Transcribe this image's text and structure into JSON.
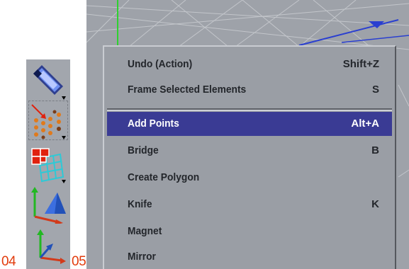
{
  "captions": {
    "left": "04",
    "right": "05"
  },
  "toolbar": {
    "tools": [
      {
        "icon": "pen-tool-icon"
      },
      {
        "icon": "add-points-tool-icon",
        "selected": true
      },
      {
        "icon": "polygon-grid-tool-icon"
      },
      {
        "icon": "axis-transform-icon"
      },
      {
        "icon": "axis-coordinate-icon"
      }
    ]
  },
  "context_menu": {
    "items": [
      {
        "label": "Undo (Action)",
        "shortcut": "Shift+Z"
      },
      {
        "label": "Frame Selected Elements",
        "shortcut": "S"
      },
      {
        "label": "Add Points",
        "shortcut": "Alt+A",
        "highlighted": true
      },
      {
        "label": "Bridge",
        "shortcut": "B"
      },
      {
        "label": "Create Polygon",
        "shortcut": ""
      },
      {
        "label": "Knife",
        "shortcut": "K"
      },
      {
        "label": "Magnet",
        "shortcut": ""
      },
      {
        "label": "Mirror",
        "shortcut": ""
      }
    ]
  },
  "colors": {
    "highlight": "#3a3b94",
    "caption": "#e23b0c",
    "menu_background": "#9a9ea5"
  }
}
